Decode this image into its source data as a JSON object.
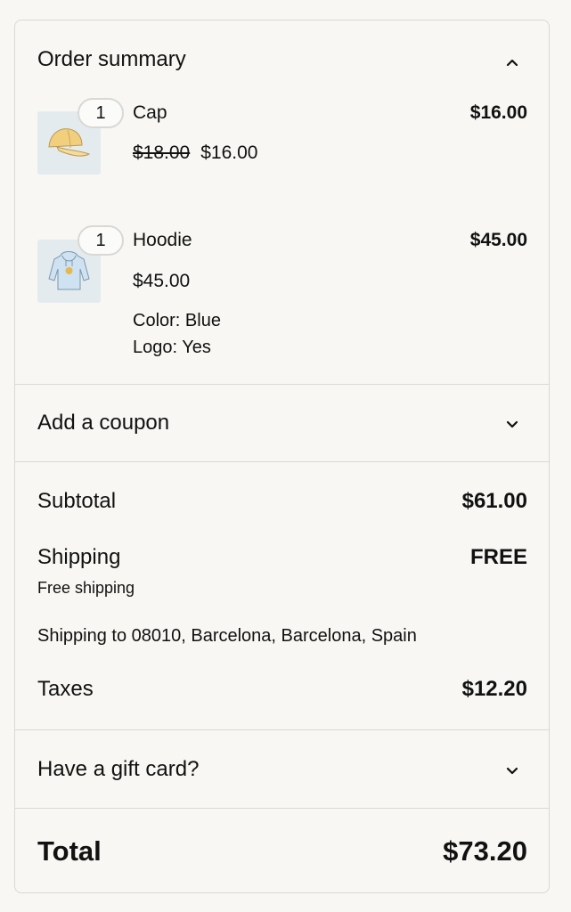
{
  "summary": {
    "title": "Order summary",
    "toggle_icon": "chevron-up-icon"
  },
  "items": [
    {
      "quantity": "1",
      "name": "Cap",
      "line_total": "$16.00",
      "original_price": "$18.00",
      "price": "$16.00",
      "image_icon": "cap-icon",
      "options": []
    },
    {
      "quantity": "1",
      "name": "Hoodie",
      "line_total": "$45.00",
      "price": "$45.00",
      "image_icon": "hoodie-icon",
      "options": [
        "Color: Blue",
        "Logo: Yes"
      ]
    }
  ],
  "coupon": {
    "label": "Add a coupon",
    "icon": "chevron-down-icon"
  },
  "totals": {
    "subtotal_label": "Subtotal",
    "subtotal_value": "$61.00",
    "shipping_label": "Shipping",
    "shipping_value": "FREE",
    "shipping_method": "Free shipping",
    "shipping_to": "Shipping to 08010, Barcelona, Barcelona, Spain",
    "taxes_label": "Taxes",
    "taxes_value": "$12.20"
  },
  "gift_card": {
    "label": "Have a gift card?",
    "icon": "chevron-down-icon"
  },
  "grand_total": {
    "label": "Total",
    "value": "$73.20"
  },
  "colors": {
    "background": "#f8f7f3",
    "border": "#d9d8d4",
    "thumb_bg": "#e4ebef",
    "cap_yellow": "#f2cf7d",
    "hoodie_blue": "#cfe2f1"
  }
}
